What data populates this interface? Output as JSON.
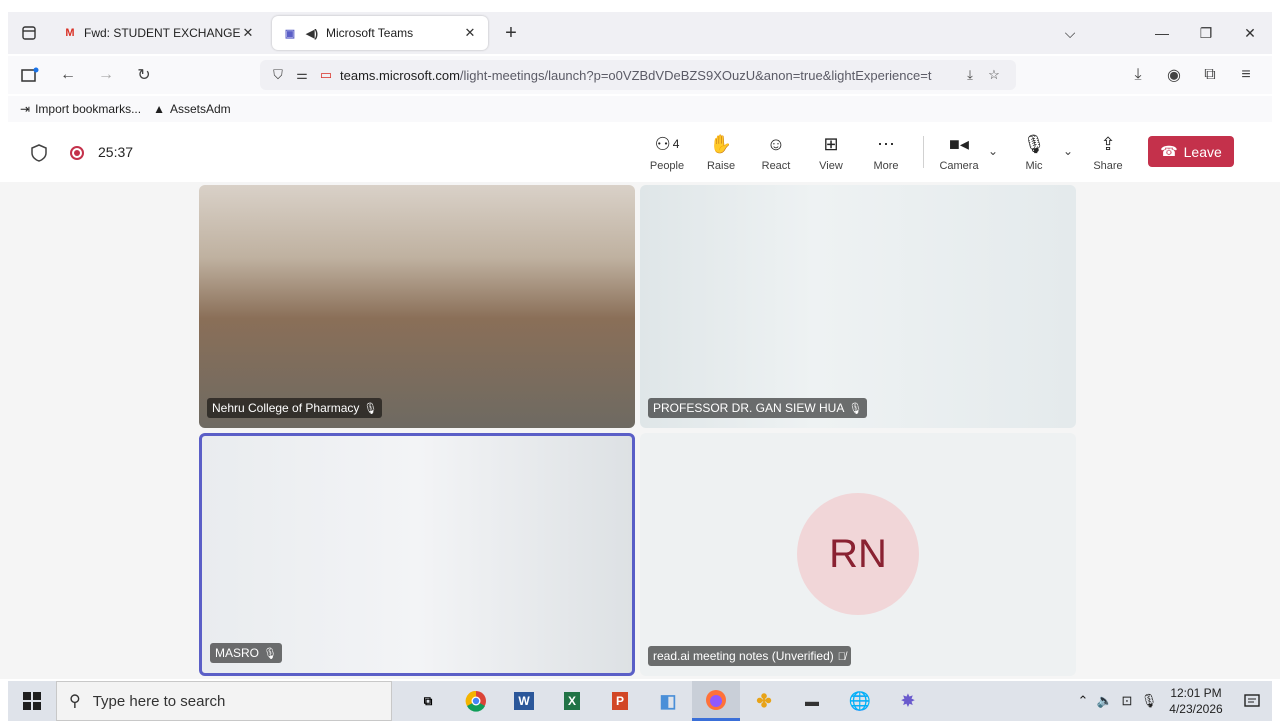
{
  "browser": {
    "tabs": [
      {
        "title": "Fwd: STUDENT EXCHANGE PRO",
        "favicon": "gmail-icon"
      },
      {
        "title": "Microsoft Teams",
        "favicon": "teams-icon",
        "audio": "speaker-icon"
      }
    ],
    "url_host": "teams.microsoft.com",
    "url_path": "/light-meetings/launch?p=o0VZBdVDeBZS9XOuzU&anon=true&lightExperience=t",
    "bookmarks": [
      {
        "label": "Import bookmarks...",
        "icon": "import-icon"
      },
      {
        "label": "AssetsAdm",
        "icon": "assets-logo-icon"
      }
    ]
  },
  "meeting": {
    "elapsed": "25:37",
    "people_count": "4",
    "toolbar": {
      "people": "People",
      "raise": "Raise",
      "react": "React",
      "view": "View",
      "more": "More",
      "camera": "Camera",
      "mic": "Mic",
      "share": "Share",
      "leave": "Leave"
    },
    "tiles": [
      {
        "name": "Nehru College of Pharmacy"
      },
      {
        "name": "PROFESSOR DR. GAN SIEW HUA"
      },
      {
        "name": "MASRO"
      },
      {
        "name": "read.ai meeting notes (Unverified)",
        "initials": "RN"
      }
    ],
    "colors": {
      "leave": "#c4314b",
      "active_speaker": "#5b5fc7",
      "avatar_bg": "#f1d6d8"
    }
  },
  "taskbar": {
    "search_placeholder": "Type here to search",
    "time": "12:01 PM",
    "date": "4/23/2026"
  }
}
